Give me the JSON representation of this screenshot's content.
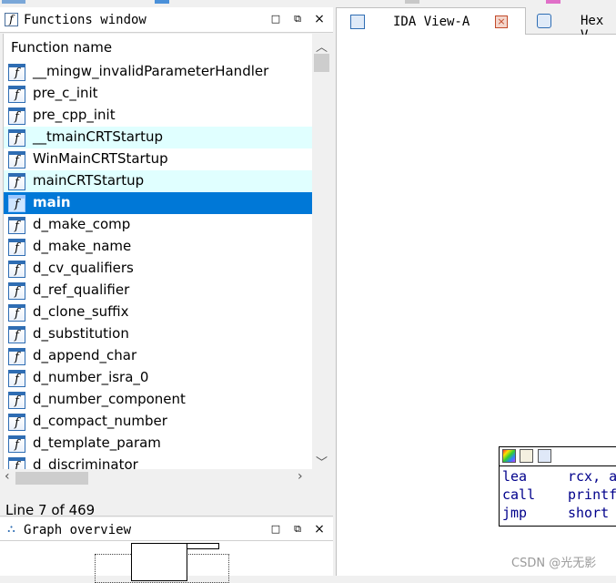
{
  "functions_window": {
    "title": "Functions window",
    "column_header": "Function name",
    "status": "Line 7 of 469",
    "functions": [
      {
        "name": "__mingw_invalidParameterHandler",
        "state": "normal"
      },
      {
        "name": "pre_c_init",
        "state": "normal"
      },
      {
        "name": "pre_cpp_init",
        "state": "normal"
      },
      {
        "name": "__tmainCRTStartup",
        "state": "highlight"
      },
      {
        "name": "WinMainCRTStartup",
        "state": "normal"
      },
      {
        "name": "mainCRTStartup",
        "state": "highlight"
      },
      {
        "name": "main",
        "state": "selected"
      },
      {
        "name": "d_make_comp",
        "state": "normal"
      },
      {
        "name": "d_make_name",
        "state": "normal"
      },
      {
        "name": "d_cv_qualifiers",
        "state": "normal"
      },
      {
        "name": "d_ref_qualifier",
        "state": "normal"
      },
      {
        "name": "d_clone_suffix",
        "state": "normal"
      },
      {
        "name": "d_substitution",
        "state": "normal"
      },
      {
        "name": "d_append_char",
        "state": "normal"
      },
      {
        "name": "d_number_isra_0",
        "state": "normal"
      },
      {
        "name": "d_number_component",
        "state": "normal"
      },
      {
        "name": "d_compact_number",
        "state": "normal"
      },
      {
        "name": "d_template_param",
        "state": "normal"
      },
      {
        "name": "d_discriminator",
        "state": "normal"
      }
    ]
  },
  "graph_overview": {
    "title": "Graph overview"
  },
  "tabs": [
    {
      "label": "IDA View-A",
      "active": true
    },
    {
      "label": "Hex V",
      "active": false
    }
  ],
  "asm_node": {
    "lines": [
      {
        "mnemonic": "lea",
        "operand": "rcx, a"
      },
      {
        "mnemonic": "call",
        "operand": "printf"
      },
      {
        "mnemonic": "jmp",
        "operand": "short"
      }
    ]
  },
  "watermark": "CSDN @光无影",
  "colors": {
    "selection": "#0078d7",
    "highlight_row": "#e0ffff",
    "asm_text": "#00008b"
  }
}
